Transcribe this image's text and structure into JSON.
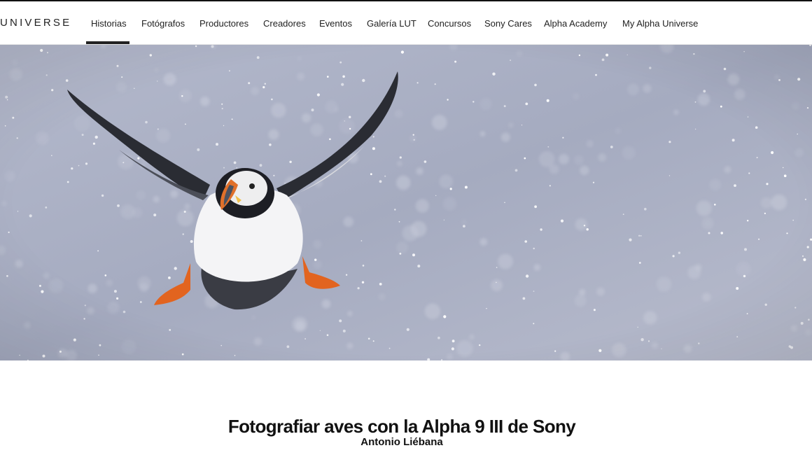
{
  "header": {
    "logo_text": "UNIVERSE",
    "nav": [
      {
        "label": "Historias",
        "active": true
      },
      {
        "label": "Fotógrafos"
      },
      {
        "label": "Productores"
      },
      {
        "label": "Creadores"
      },
      {
        "label": "Eventos"
      },
      {
        "label": "Galería LUT"
      },
      {
        "label": "Concursos"
      },
      {
        "label": "Sony Cares"
      },
      {
        "label": "Alpha Academy"
      },
      {
        "label": "My Alpha Universe"
      }
    ]
  },
  "hero": {
    "subject": "puffin-in-snow"
  },
  "article": {
    "title": "Fotografiar aves con la Alpha 9 III de Sony",
    "author": "Antonio Liébana"
  },
  "colors": {
    "text": "#111111",
    "hero_bg": "#a9afc4",
    "beak_orange": "#e0702a"
  }
}
